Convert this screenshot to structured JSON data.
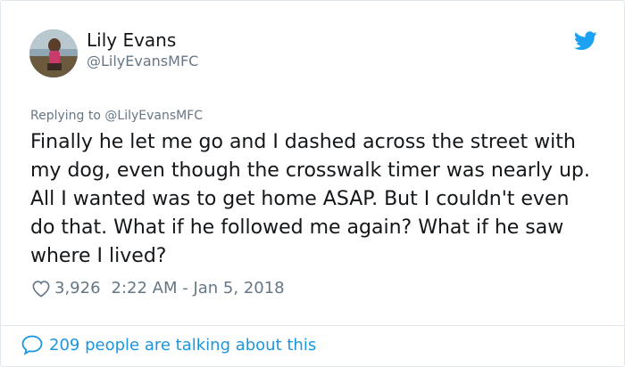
{
  "author": {
    "name": "Lily Evans",
    "handle": "@LilyEvansMFC"
  },
  "reply": {
    "prefix": "Replying to",
    "handle": "@LilyEvansMFC"
  },
  "tweet": {
    "text": "Finally he let me go and I dashed across the street with my dog, even though the crosswalk timer was nearly up. All I wanted was to get home ASAP. But I couldn't even do that. What if he followed me again? What if he saw where I lived?",
    "likes": "3,926",
    "timestamp": "2:22 AM - Jan 5, 2018"
  },
  "footer": {
    "talking": "209 people are talking about this"
  },
  "colors": {
    "brand": "#1da1f2",
    "link": "#1b95e0",
    "muted": "#657786",
    "text": "#14171a"
  },
  "icons": {
    "logo": "twitter-bird-icon",
    "like": "heart-icon",
    "talk": "speech-bubble-icon"
  }
}
